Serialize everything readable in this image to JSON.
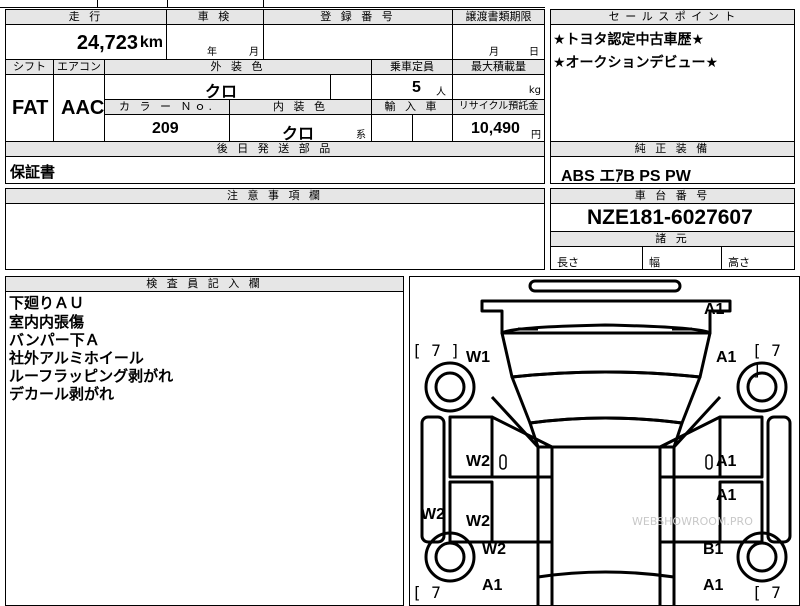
{
  "headers": {
    "mileage": "走 行",
    "inspection": "車 検",
    "reg_no": "登 録 番 号",
    "transfer_due": "譲渡書類期限",
    "sales_point": "セ ー ル ス ポ イ ン ト",
    "shift": "シフト",
    "aircon": "エアコン",
    "ext_color": "外 装 色",
    "capacity": "乗車定員",
    "max_load": "最大積載量",
    "color_no": "カ ラ ー Ｎｏ.",
    "int_color": "内 装 色",
    "import": "輸 入 車",
    "recycle": "リサイクル預託金",
    "later_parts": "後 日 発 送 部 品",
    "genuine": "純 正 装 備",
    "caution": "注 意 事 項 欄",
    "chassis": "車 台 番 号",
    "dimensions": "諸 元",
    "inspector": "検 査 員 記 入 欄"
  },
  "mileage": {
    "value": "24,723",
    "unit": "km"
  },
  "inspection": {
    "year": "年",
    "month": "月"
  },
  "transfer_due": {
    "month": "月",
    "day": "日"
  },
  "sales_points": [
    "★トヨタ認定中古車歴★",
    "★オークションデビュー★"
  ],
  "shift": "FAT",
  "aircon": "AAC",
  "ext_color": "クロ",
  "capacity": {
    "value": "5",
    "unit": "人"
  },
  "max_load_unit": "kg",
  "color_no": "209",
  "int_color": {
    "value": "クロ",
    "suffix": "系"
  },
  "recycle": {
    "value": "10,490",
    "unit": "円"
  },
  "later_parts": "保証書",
  "genuine": "ABS エｱB PS PW",
  "chassis": "NZE181-6027607",
  "dims": {
    "length": "長さ",
    "width": "幅",
    "height": "高さ"
  },
  "inspector_notes": [
    "下廻りＡＵ",
    "室内内張傷",
    "バンパー下Ａ",
    "社外アルミホイール",
    "ルーフラッピング剥がれ",
    "デカール剥がれ"
  ],
  "diagram": {
    "left_bracket_top": "[ 7 ]",
    "right_bracket_top": "[ 7 ]",
    "left_bracket_bottom": "[ 7",
    "right_bracket_bottom": "[ 7 ]",
    "marks": {
      "front_bumper": "A1",
      "front_left_fender": "W1",
      "front_right_fender": "A1",
      "left_front_door": "W2",
      "right_front_door": "A1",
      "left_rear_door": "W2",
      "right_rear_door": "A1",
      "left_sill": "W2",
      "left_quarter": "W2",
      "right_quarter": "B1",
      "rear_left": "A1",
      "rear_right": "A1"
    },
    "watermark": "WEBSHOWROOM.PRO"
  }
}
